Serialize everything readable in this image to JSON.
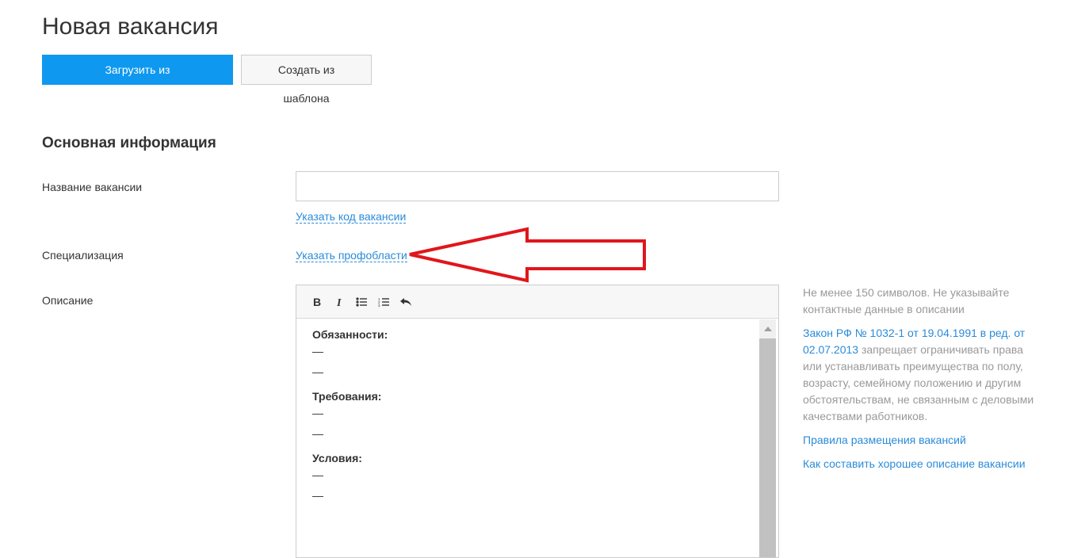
{
  "page": {
    "title": "Новая вакансия"
  },
  "actions": {
    "load_unpublished": "Загрузить из неопубликованных",
    "create_from_template": "Создать из шаблона"
  },
  "section": {
    "title": "Основная информация"
  },
  "form": {
    "vacancy_name": {
      "label": "Название вакансии",
      "value": "",
      "code_link": "Указать код вакансии"
    },
    "specialization": {
      "label": "Специализация",
      "link": "Указать профобласти"
    },
    "description": {
      "label": "Описание",
      "toolbar": [
        "bold-icon",
        "italic-icon",
        "bulleted-list-icon",
        "numbered-list-icon",
        "undo-icon"
      ],
      "blocks": [
        {
          "heading": "Обязанности:",
          "lines": [
            "—",
            "—"
          ]
        },
        {
          "heading": "Требования:",
          "lines": [
            "—",
            "—"
          ]
        },
        {
          "heading": "Условия:",
          "lines": [
            "—",
            "—"
          ]
        }
      ]
    }
  },
  "help": {
    "min_chars": "Не менее 150 символов. Не указывайте контактные данные в описании",
    "law_link": "Закон РФ № 1032-1 от 19.04.1991 в ред. от 02.07.2013",
    "law_text": " запрещает ограничивать права или устанавливать преимущества по полу, возрасту, семейному положению и другим обстоятельствам, не связанным с деловыми качествами работников.",
    "rules_link": "Правила размещения вакансий",
    "howto_link": "Как составить хорошее описание вакансии"
  },
  "colors": {
    "primary": "#0f98f0",
    "link": "#2a8bd9",
    "annotation_arrow": "#e0161b"
  }
}
